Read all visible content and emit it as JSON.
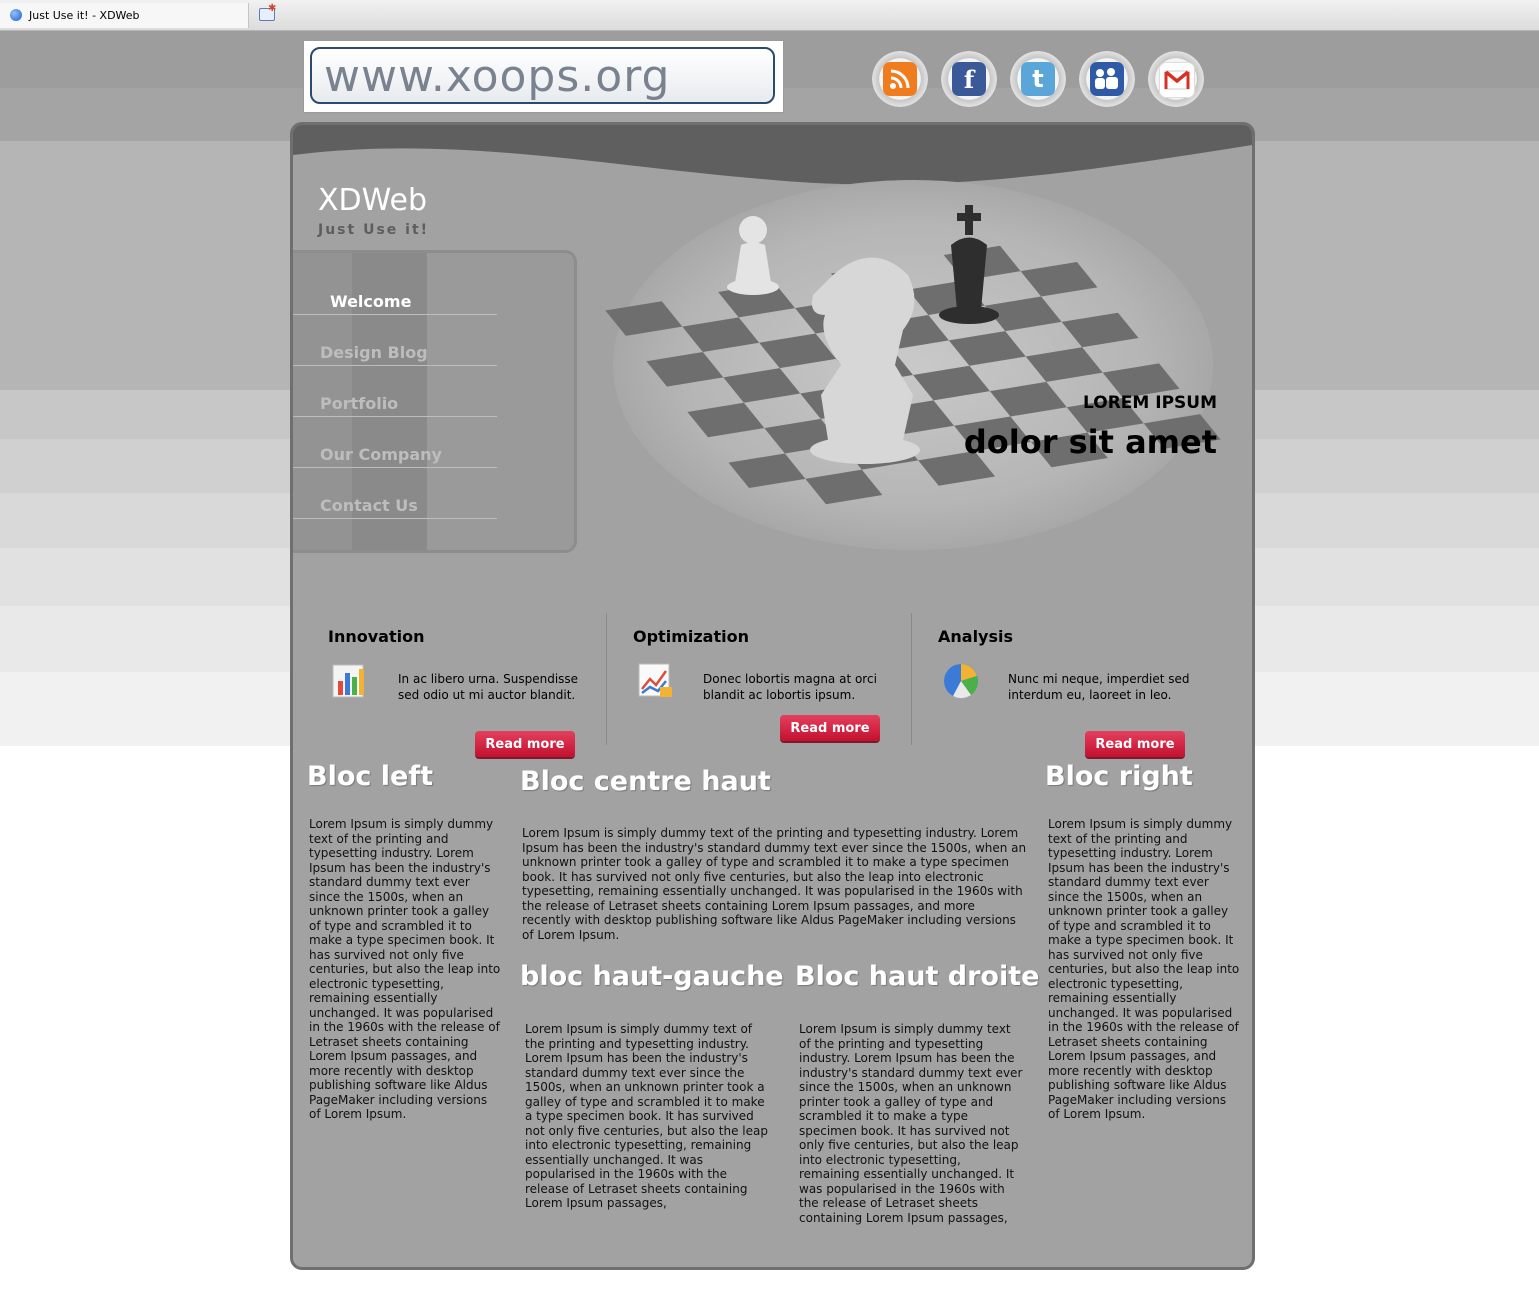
{
  "browser": {
    "tab_title": "Just Use it! - XDWeb"
  },
  "header": {
    "logo_text": "www.xoops.org",
    "social": [
      {
        "name": "rss",
        "color": "#f07c1e",
        "glyph": "◕"
      },
      {
        "name": "facebook",
        "color": "#3b5998",
        "glyph": "f"
      },
      {
        "name": "twitter",
        "color": "#5aa6d8",
        "glyph": "t"
      },
      {
        "name": "myspace",
        "color": "#2f5aa7",
        "glyph": "☻"
      },
      {
        "name": "gmail",
        "color": "#ffffff",
        "glyph": "M"
      }
    ]
  },
  "site": {
    "title": "XDWeb",
    "slogan": "Just Use it!"
  },
  "nav": [
    {
      "label": "Welcome",
      "active": true
    },
    {
      "label": "Design Blog"
    },
    {
      "label": "Portfolio"
    },
    {
      "label": "Our Company"
    },
    {
      "label": "Contact Us"
    }
  ],
  "hero": {
    "subtitle": "LOREM IPSUM",
    "headline": "dolor sit amet"
  },
  "features": [
    {
      "title": "Innovation",
      "text": "In ac libero urna. Suspendisse sed odio ut mi auctor blandit.",
      "button": "Read more"
    },
    {
      "title": "Optimization",
      "text": "Donec lobortis magna at orci blandit ac lobortis ipsum.",
      "button": "Read more"
    },
    {
      "title": "Analysis",
      "text": "Nunc mi neque, imperdiet sed interdum eu, laoreet in leo.",
      "button": "Read more"
    }
  ],
  "blocs": {
    "left": {
      "title": "Bloc left",
      "text": "Lorem Ipsum is simply dummy text of the printing and typesetting industry. Lorem Ipsum has been the industry's standard dummy text ever since the 1500s, when an unknown printer took a galley of type and scrambled it to make a type specimen book. It has survived not only five centuries, but also the leap into electronic typesetting, remaining essentially unchanged. It was popularised in the 1960s with the release of Letraset sheets containing Lorem Ipsum passages, and more recently with desktop publishing software like Aldus PageMaker including versions of Lorem Ipsum."
    },
    "centre": {
      "title": "Bloc centre haut",
      "text": "Lorem Ipsum is simply dummy text of the printing and typesetting industry. Lorem Ipsum has been the industry's standard dummy text ever since the 1500s, when an unknown printer took a galley of type and scrambled it to make a type specimen book. It has survived not only five centuries, but also the leap into electronic typesetting, remaining essentially unchanged. It was popularised in the 1960s with the release of Letraset sheets containing Lorem Ipsum passages, and more recently with desktop publishing software like Aldus PageMaker including versions of Lorem Ipsum."
    },
    "haut_gauche": {
      "title": "bloc haut-gauche",
      "text": "Lorem Ipsum is simply dummy text of the printing and typesetting industry. Lorem Ipsum has been the industry's standard dummy text ever since the 1500s, when an unknown printer took a galley of type and scrambled it to make a type specimen book. It has survived not only five centuries, but also the leap into electronic typesetting, remaining essentially unchanged. It was popularised in the 1960s with the release of Letraset sheets containing Lorem Ipsum passages,"
    },
    "haut_droite": {
      "title": "Bloc haut droite",
      "text": "Lorem Ipsum is simply dummy text of the printing and typesetting industry. Lorem Ipsum has been the industry's standard dummy text ever since the 1500s, when an unknown printer took a galley of type and scrambled it to make a type specimen book. It has survived not only five centuries, but also the leap into electronic typesetting, remaining essentially unchanged. It was popularised in the 1960s with the release of Letraset sheets containing Lorem Ipsum passages,"
    },
    "right": {
      "title": "Bloc right",
      "text": "Lorem Ipsum is simply dummy text of the printing and typesetting industry. Lorem Ipsum has been the industry's standard dummy text ever since the 1500s, when an unknown printer took a galley of type and scrambled it to make a type specimen book. It has survived not only five centuries, but also the leap into electronic typesetting, remaining essentially unchanged. It was popularised in the 1960s with the release of Letraset sheets containing Lorem Ipsum passages, and more recently with desktop publishing software like Aldus PageMaker including versions of Lorem Ipsum."
    }
  },
  "colors": {
    "card_bg": "#a2a2a2",
    "button_red": "#d21e3e"
  }
}
